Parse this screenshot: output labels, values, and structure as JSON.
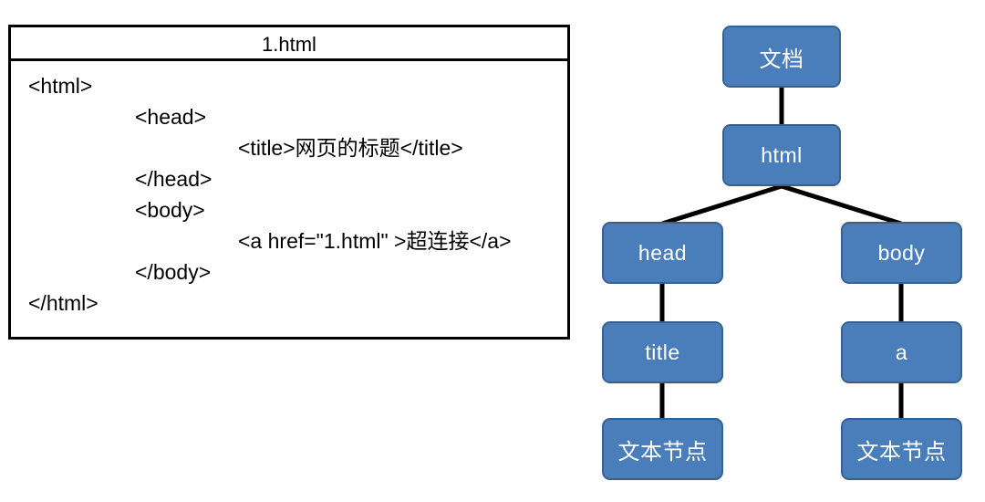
{
  "code_card": {
    "title": "1.html",
    "lines": [
      {
        "indent": 0,
        "text": "<html>"
      },
      {
        "indent": 1,
        "text": "<head>"
      },
      {
        "indent": 2,
        "text": "<title>网页的标题</title>"
      },
      {
        "indent": 1,
        "text": "</head>"
      },
      {
        "indent": 1,
        "text": "<body>"
      },
      {
        "indent": 2,
        "text": "<a href=\"1.html\" >超连接</a>"
      },
      {
        "indent": 1,
        "text": "</body>"
      },
      {
        "indent": 0,
        "text": "</html>"
      }
    ]
  },
  "dom_tree": {
    "nodes": [
      {
        "id": "document",
        "label": "文档"
      },
      {
        "id": "html",
        "label": "html"
      },
      {
        "id": "head",
        "label": "head"
      },
      {
        "id": "body",
        "label": "body"
      },
      {
        "id": "title",
        "label": "title"
      },
      {
        "id": "a",
        "label": "a"
      },
      {
        "id": "text-node-title",
        "label": "文本节点"
      },
      {
        "id": "text-node-a",
        "label": "文本节点"
      }
    ],
    "edges": [
      {
        "from": "document",
        "to": "html"
      },
      {
        "from": "html",
        "to": "head"
      },
      {
        "from": "html",
        "to": "body"
      },
      {
        "from": "head",
        "to": "title"
      },
      {
        "from": "title",
        "to": "text-node-title"
      },
      {
        "from": "body",
        "to": "a"
      },
      {
        "from": "a",
        "to": "text-node-a"
      }
    ]
  },
  "colors": {
    "node_fill": "#4a7ebb",
    "node_border": "#37618e",
    "node_text": "#ffffff",
    "connector": "#000000",
    "card_border": "#000000",
    "card_background": "#ffffff",
    "code_text": "#000000"
  }
}
